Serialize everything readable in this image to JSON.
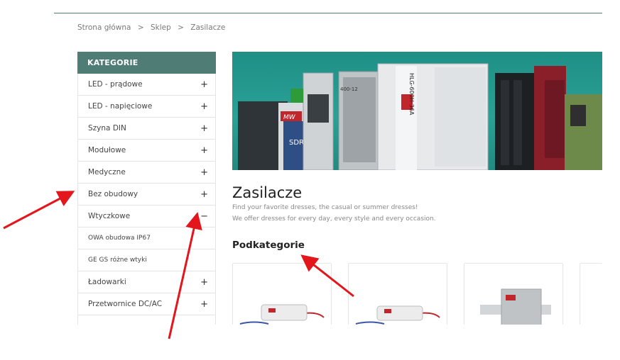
{
  "breadcrumb": {
    "items": [
      "Strona główna",
      "Sklep",
      "Zasilacze"
    ],
    "separator": ">"
  },
  "sidebar": {
    "title": "KATEGORIE",
    "items": [
      {
        "label": "LED - prądowe",
        "toggle": "+"
      },
      {
        "label": "LED - napięciowe",
        "toggle": "+"
      },
      {
        "label": "Szyna DIN",
        "toggle": "+"
      },
      {
        "label": "Modułowe",
        "toggle": "+"
      },
      {
        "label": "Medyczne",
        "toggle": "+"
      },
      {
        "label": "Bez obudowy",
        "toggle": "+"
      },
      {
        "label": "Wtyczkowe",
        "toggle": "−"
      }
    ],
    "subitems": [
      "OWA obudowa IP67",
      "GE GS różne wtyki"
    ],
    "items_after": [
      {
        "label": "Ładowarki",
        "toggle": "+"
      },
      {
        "label": "Przetwornice DC/AC",
        "toggle": "+"
      }
    ]
  },
  "main": {
    "title": "Zasilacze",
    "description_line1": "Find your favorite dresses, the casual or summer dresses!",
    "description_line2": "We offer dresses for every day, every style and every occasion.",
    "subcategories_heading": "Podkategorie"
  },
  "banner_product_labels": [
    "MW",
    "SDR",
    "HLG-600H-36A",
    "400-12"
  ],
  "colors": {
    "accent": "#4f7d76",
    "banner": "#2aa196",
    "annotation_arrow": "#e3161c"
  }
}
